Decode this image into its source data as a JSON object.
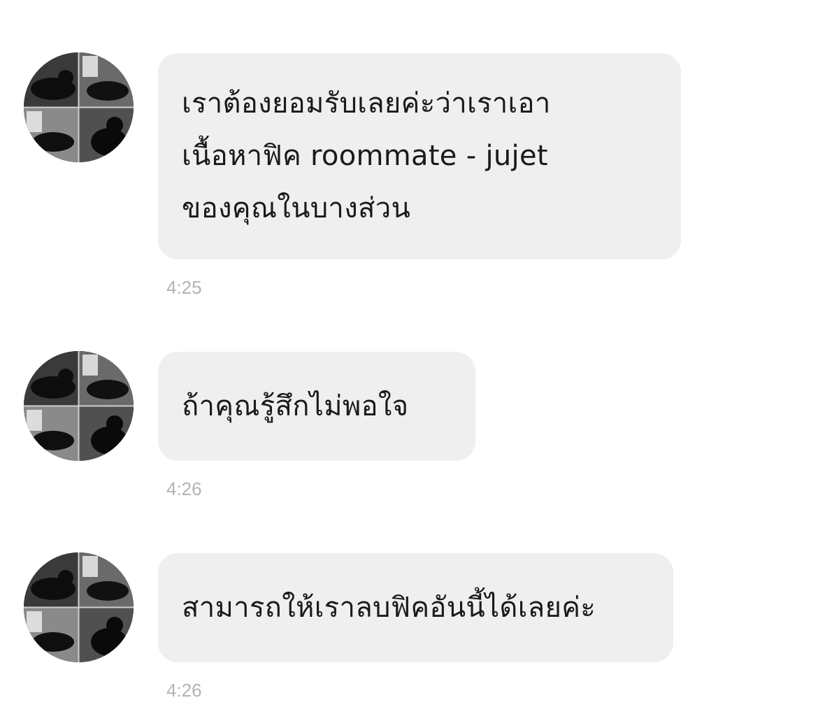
{
  "messages": [
    {
      "avatar": "cat-collage-avatar",
      "text": "เราต้องยอมรับเลยค่ะว่าเราเอา\nเนื้อหาฟิค roommate - jujet\nของคุณในบางส่วน",
      "time": "4:25"
    },
    {
      "avatar": "cat-collage-avatar",
      "text": "ถ้าคุณรู้สึกไม่พอใจ",
      "time": "4:26"
    },
    {
      "avatar": "cat-collage-avatar",
      "text": "สามารถให้เราลบฟิคอันนี้ได้เลยค่ะ",
      "time": "4:26"
    }
  ],
  "colors": {
    "bubble": "#efefef",
    "text": "#1a1a1a",
    "timestamp": "#b3b3b3",
    "background": "#ffffff"
  }
}
